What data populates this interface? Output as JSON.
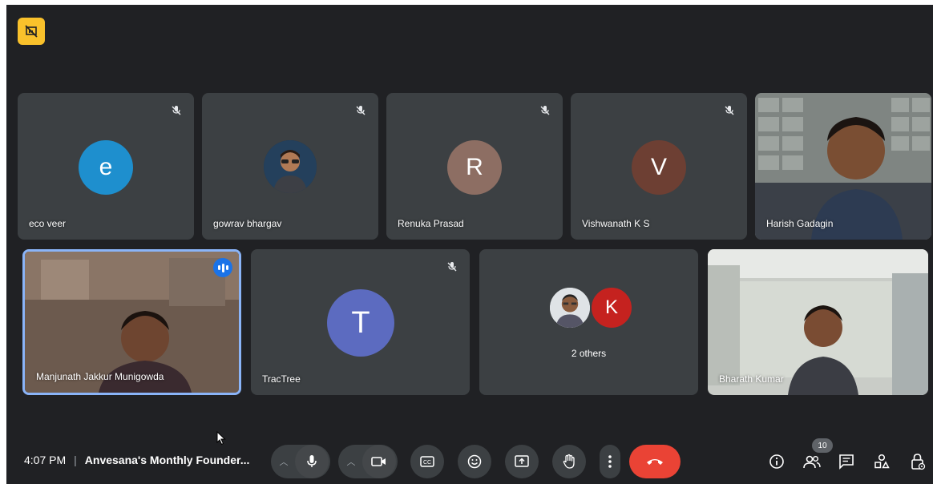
{
  "participants": [
    {
      "name": "eco veer",
      "initial": "e",
      "color": "#1e8fce",
      "muted": true
    },
    {
      "name": "gowrav bhargav",
      "initial": "",
      "muted": true
    },
    {
      "name": "Renuka Prasad",
      "initial": "R",
      "color": "#8d6e63",
      "muted": true
    },
    {
      "name": "Vishwanath K S",
      "initial": "V",
      "color": "#6d3f33",
      "muted": true
    },
    {
      "name": "Harish Gadagin",
      "video": true
    },
    {
      "name": "Manjunath Jakkur Munigowda",
      "video": true,
      "speaking": true
    },
    {
      "name": "TracTree",
      "initial": "T",
      "color": "#5c6bc0",
      "muted": true
    },
    {
      "name": "2 others",
      "initial": "K",
      "color": "#c5221f"
    },
    {
      "name": "Bharath Kumar",
      "video": true
    }
  ],
  "bottom_bar": {
    "time": "4:07 PM",
    "meeting_title": "Anvesana's Monthly Founder...",
    "people_count": "10"
  },
  "colors": {
    "background": "#202124",
    "tile": "#3c4043",
    "end_call": "#ea4335",
    "speaking_border": "#8ab4f8"
  },
  "icons": {
    "corner": "presentation-off-icon",
    "controls": [
      "chevron-up-icon",
      "mic-icon",
      "chevron-up-icon",
      "camera-icon",
      "captions-icon",
      "emoji-icon",
      "present-icon",
      "raise-hand-icon",
      "more-vert-icon",
      "end-call-icon"
    ],
    "right": [
      "info-icon",
      "people-icon",
      "chat-icon",
      "activities-icon",
      "host-controls-icon"
    ]
  }
}
